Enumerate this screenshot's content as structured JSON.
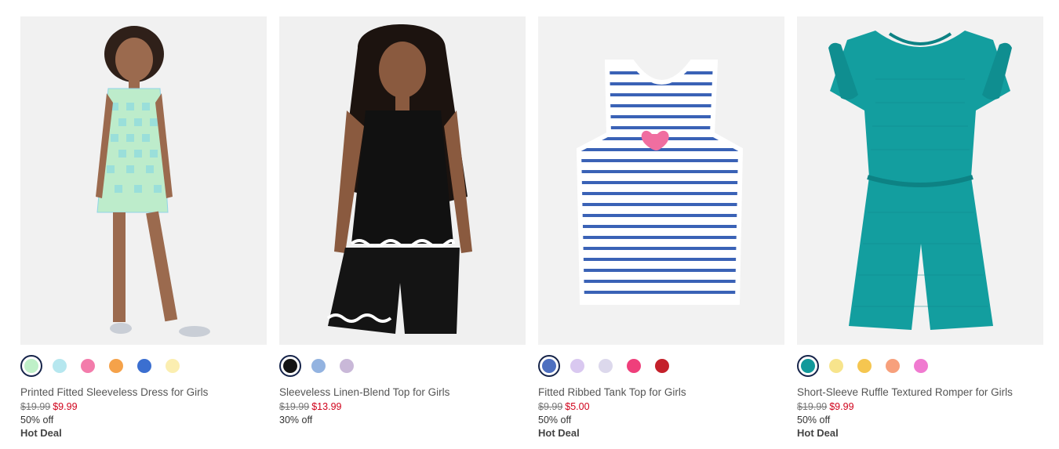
{
  "products": [
    {
      "name": "Printed Fitted Sleeveless Dress for Girls",
      "original_price": "$19.99",
      "sale_price": "$9.99",
      "discount": "50% off",
      "badge": "Hot Deal",
      "swatches": [
        "#bff0c8",
        "#b6e7ef",
        "#f37cab",
        "#f5a24a",
        "#3b6fd0",
        "#fbeeb0"
      ],
      "selected_swatch": 0
    },
    {
      "name": "Sleeveless Linen-Blend Top for Girls",
      "original_price": "$19.99",
      "sale_price": "$13.99",
      "discount": "30% off",
      "badge": "",
      "swatches": [
        "#151515",
        "#93b3e0",
        "#c9b8d8"
      ],
      "selected_swatch": 0
    },
    {
      "name": "Fitted Ribbed Tank Top for Girls",
      "original_price": "$9.99",
      "sale_price": "$5.00",
      "discount": "50% off",
      "badge": "Hot Deal",
      "swatches": [
        "#4d6fc0",
        "#d9c8f0",
        "#dcd8ec",
        "#ef3f7b",
        "#c4202a"
      ],
      "selected_swatch": 0
    },
    {
      "name": "Short-Sleeve Ruffle Textured Romper for Girls",
      "original_price": "$19.99",
      "sale_price": "$9.99",
      "discount": "50% off",
      "badge": "Hot Deal",
      "swatches": [
        "#12999a",
        "#f7e48c",
        "#f5c650",
        "#f7a07c",
        "#f07ad0"
      ],
      "selected_swatch": 0
    }
  ],
  "colors": {
    "sale": "#d0021b",
    "selected_ring": "#16244a",
    "image_bg": "#f0f0f0"
  }
}
